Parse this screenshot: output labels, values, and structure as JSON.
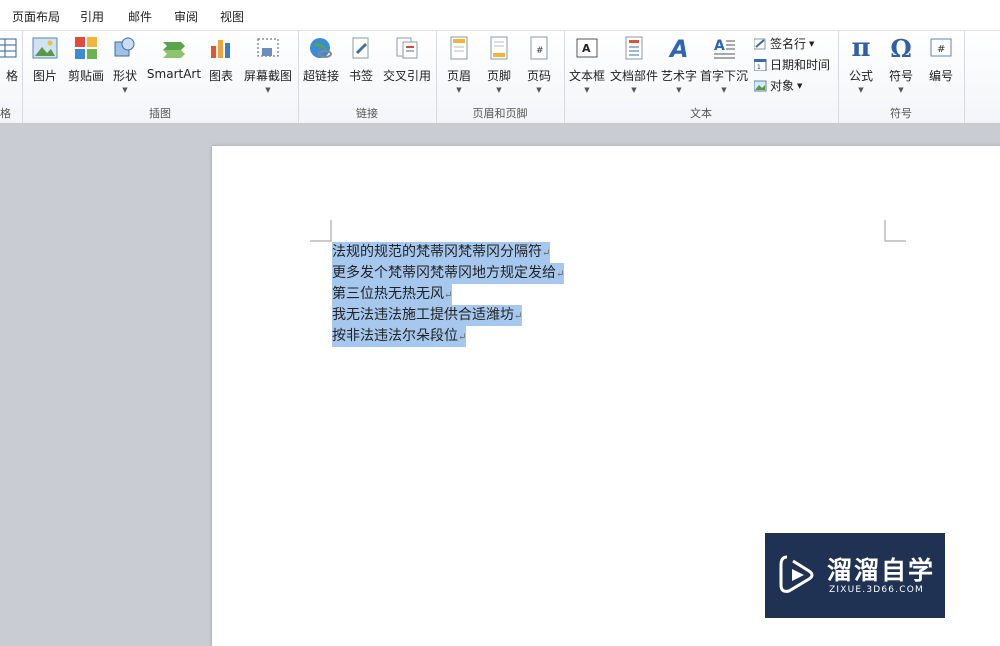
{
  "menu": {
    "tabs": [
      "页面布局",
      "引用",
      "邮件",
      "审阅",
      "视图"
    ]
  },
  "ribbon": {
    "groups": {
      "table": {
        "label": "格",
        "button": "格"
      },
      "illustrations": {
        "label": "插图",
        "buttons": [
          "图片",
          "剪贴画",
          "形状",
          "SmartArt",
          "图表",
          "屏幕截图"
        ]
      },
      "links": {
        "label": "链接",
        "buttons": [
          "超链接",
          "书签",
          "交叉引用"
        ]
      },
      "header_footer": {
        "label": "页眉和页脚",
        "buttons": [
          "页眉",
          "页脚",
          "页码"
        ]
      },
      "text": {
        "label": "文本",
        "buttons": [
          "文本框",
          "文档部件",
          "艺术字",
          "首字下沉"
        ],
        "small_buttons": [
          "签名行",
          "日期和时间",
          "对象"
        ]
      },
      "symbols": {
        "label": "符号",
        "buttons": [
          "公式",
          "符号",
          "编号"
        ]
      }
    },
    "icon_names": [
      "table-icon",
      "picture-icon",
      "clipart-icon",
      "shapes-icon",
      "smartart-icon",
      "chart-icon",
      "screenshot-icon",
      "hyperlink-icon",
      "bookmark-icon",
      "cross-reference-icon",
      "header-icon",
      "footer-icon",
      "page-number-icon",
      "textbox-icon",
      "quick-parts-icon",
      "wordart-icon",
      "drop-cap-icon",
      "signature-line-icon",
      "date-time-icon",
      "object-icon",
      "equation-icon",
      "symbol-icon",
      "numbering-icon"
    ]
  },
  "document": {
    "lines": [
      "法规的规范的梵蒂冈梵蒂冈分隔符",
      "更多发个梵蒂冈梵蒂冈地方规定发给",
      "第三位热无热无风",
      "我无法违法施工提供合适潍坊",
      "按非法违法尔朵段位"
    ],
    "paragraph_mark": "↵",
    "selection_color": "#a7c8ee"
  },
  "watermark": {
    "title": "溜溜自学",
    "subtitle": "ZIXUE.3D66.COM"
  },
  "colors": {
    "ribbon_bg": "#f3f5f8",
    "workspace_bg": "#c9cdd3",
    "watermark_bg": "#1f3253"
  }
}
